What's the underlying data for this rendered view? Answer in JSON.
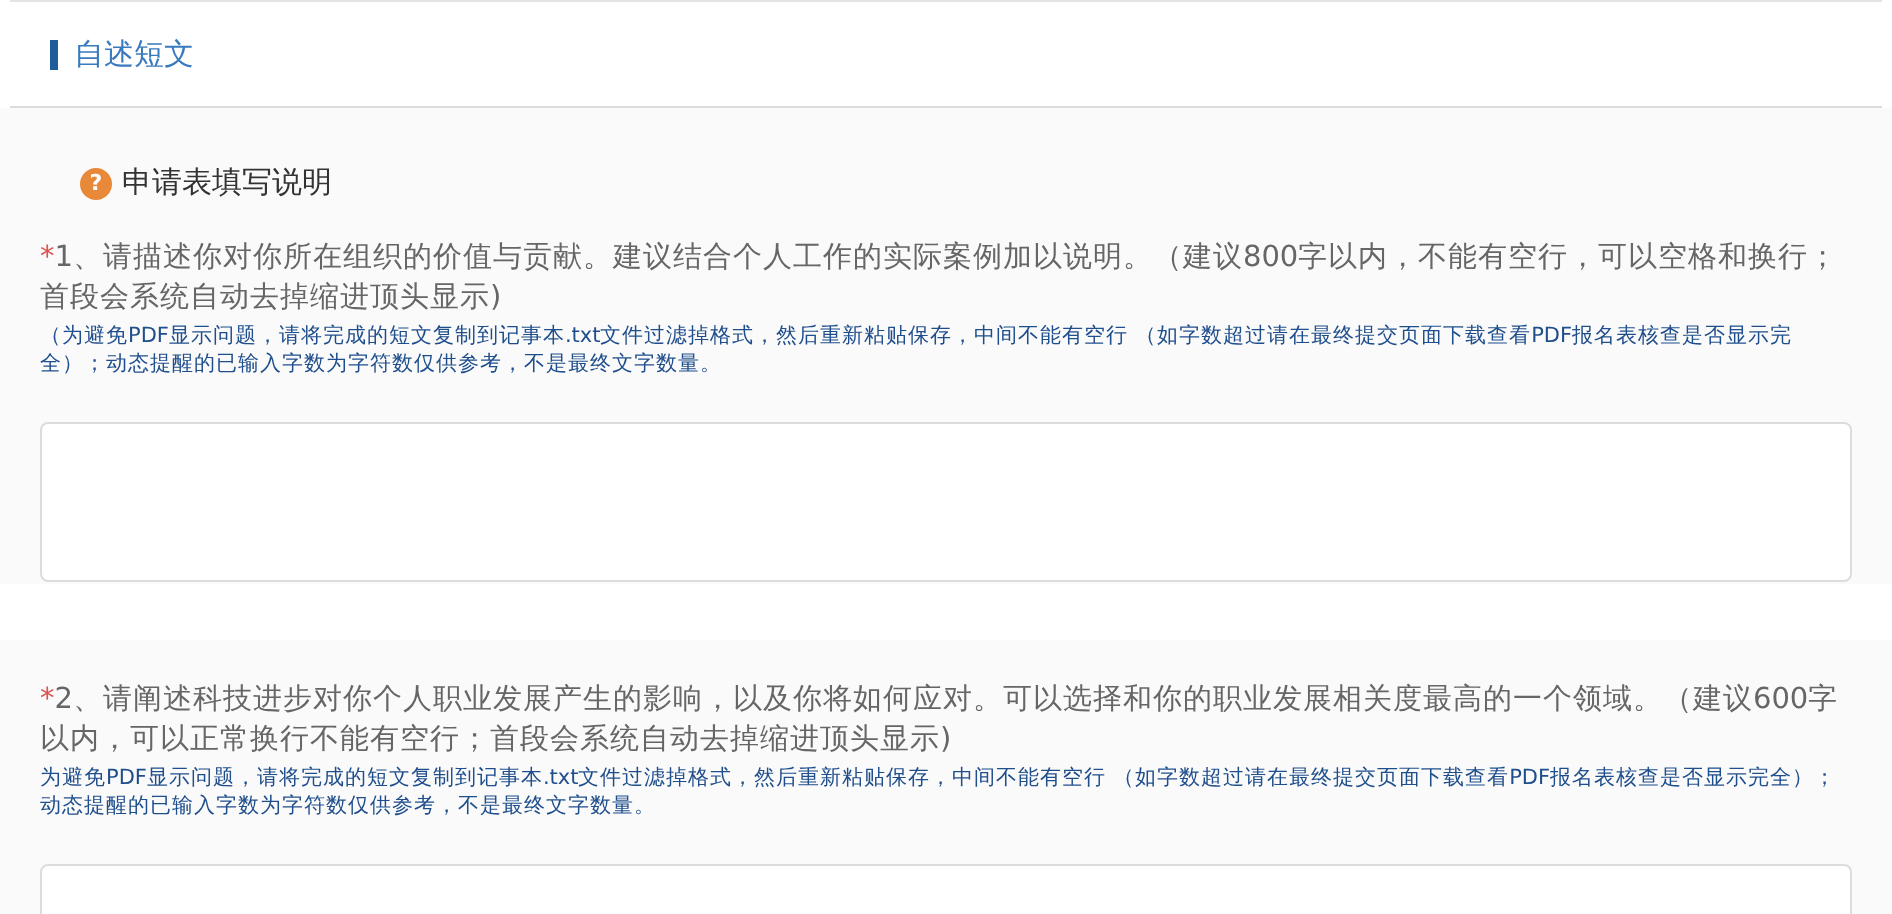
{
  "section": {
    "title": "自述短文"
  },
  "help": {
    "icon": "?",
    "label": "申请表填写说明"
  },
  "questions": [
    {
      "marker": "*",
      "text": "1、请描述你对你所在组织的价值与贡献。建议结合个人工作的实际案例加以说明。（建议800字以内，不能有空行，可以空格和换行；首段会系统自动去掉缩进顶头显示)",
      "note": "（为避免PDF显示问题，请将完成的短文复制到记事本.txt文件过滤掉格式，然后重新粘贴保存，中间不能有空行 （如字数超过请在最终提交页面下载查看PDF报名表核查是否显示完全）；动态提醒的已输入字数为字符数仅供参考，不是最终文字数量。"
    },
    {
      "marker": "*",
      "text": "2、请阐述科技进步对你个人职业发展产生的影响，以及你将如何应对。可以选择和你的职业发展相关度最高的一个领域。（建议600字以内，可以正常换行不能有空行；首段会系统自动去掉缩进顶头显示)",
      "note": "为避免PDF显示问题，请将完成的短文复制到记事本.txt文件过滤掉格式，然后重新粘贴保存，中间不能有空行 （如字数超过请在最终提交页面下载查看PDF报名表核查是否显示完全）；动态提醒的已输入字数为字符数仅供参考，不是最终文字数量。"
    }
  ]
}
